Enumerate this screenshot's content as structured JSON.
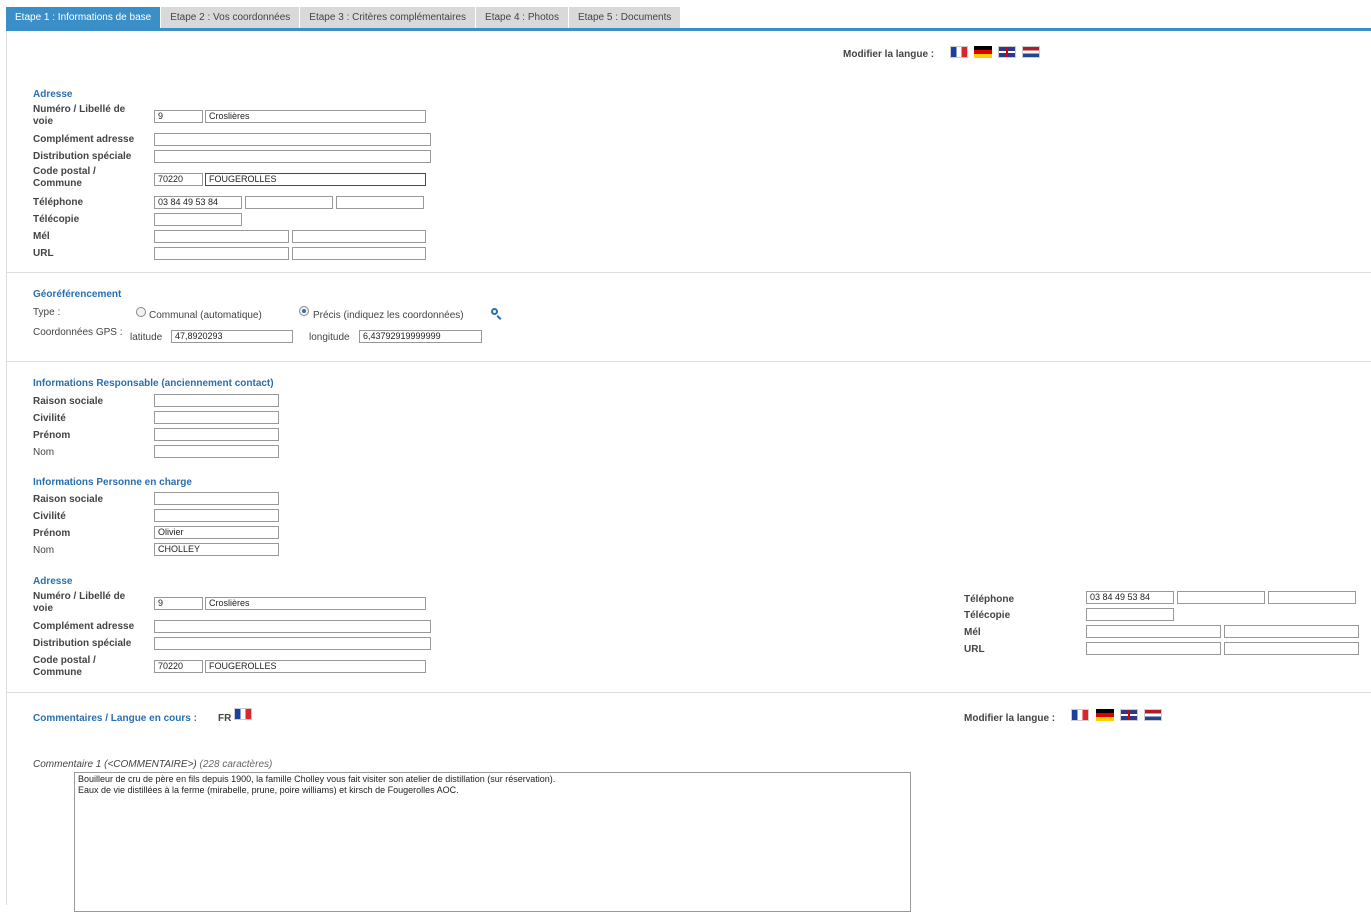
{
  "tabs": [
    "Etape 1 : Informations de base",
    "Etape 2 : Vos coordonnées",
    "Etape 3 : Critères complémentaires",
    "Etape 4 : Photos",
    "Etape 5 : Documents"
  ],
  "lang_label": "Modifier la langue :",
  "flags": [
    "fr-flag-icon",
    "de-flag-icon",
    "gb-flag-icon",
    "nl-flag-icon"
  ],
  "adresse": {
    "title": "Adresse",
    "lbl_num": "Numéro / Libellé de voie",
    "lbl_comp": "Complément adresse",
    "lbl_dist": "Distribution spéciale",
    "lbl_cp": "Code postal / Commune",
    "lbl_tel": "Téléphone",
    "lbl_fax": "Télécopie",
    "lbl_mel": "Mél",
    "lbl_url": "URL",
    "num": "9",
    "voie": "Croslières",
    "cp": "70220",
    "commune": "FOUGEROLLES",
    "tel": "03 84 49 53 84"
  },
  "geo": {
    "title": "Géoréférencement",
    "type_label": "Type :",
    "opt1": "Communal (automatique)",
    "opt2": "Précis (indiquez les coordonnées)",
    "gps_label": "Coordonnées GPS :",
    "lat_label": "latitude",
    "lat": "47,8920293",
    "lon_label": "longitude",
    "lon": "6,43792919999999"
  },
  "resp": {
    "title": "Informations Responsable (anciennement contact)",
    "raison": "Raison sociale",
    "civ": "Civilité",
    "prenom": "Prénom",
    "nom": "Nom"
  },
  "charge": {
    "title": "Informations Personne en charge",
    "prenom_val": "Olivier",
    "nom_val": "CHOLLEY"
  },
  "comments": {
    "label": "Commentaires / Langue en cours :",
    "lang": "FR",
    "c1_label": "Commentaire 1 (<COMMENTAIRE>)",
    "c1_count": "(228 caractères)",
    "c1_text": "Bouilleur de cru de père en fils depuis 1900, la famille Cholley vous fait visiter son atelier de distillation (sur réservation).\nEaux de vie distillées à la ferme (mirabelle, prune, poire williams) et kirsch de Fougerolles AOC."
  },
  "colors": {
    "accent": "#3a8fc8",
    "section": "#2a6fb0"
  }
}
